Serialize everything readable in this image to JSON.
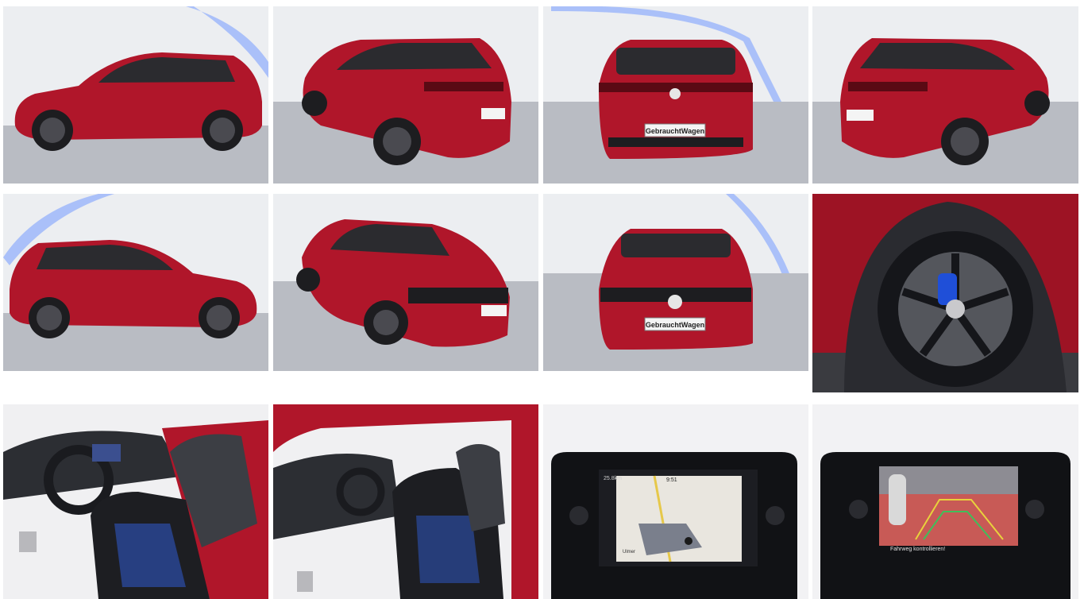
{
  "colors": {
    "body_red": "#b0162a",
    "body_red_dark": "#7c0d1c",
    "studio_wall": "#eceef1",
    "studio_floor": "#b9bcc3",
    "led_strip": "#7fa2ff",
    "caliper_blue": "#1f4fd8",
    "seat_blue": "#2f5bd0"
  },
  "gallery": {
    "photos": [
      {
        "subject": "side-left"
      },
      {
        "subject": "rear-three-quarter-left"
      },
      {
        "subject": "rear"
      },
      {
        "subject": "rear-three-quarter-right"
      },
      {
        "subject": "side-right"
      },
      {
        "subject": "front-three-quarter-left"
      },
      {
        "subject": "front"
      },
      {
        "subject": "wheel-detail"
      },
      {
        "subject": "interior-driver-seat"
      },
      {
        "subject": "interior-driver-door-open"
      },
      {
        "subject": "infotainment-navigation"
      },
      {
        "subject": "infotainment-rear-camera"
      }
    ]
  },
  "plates": {
    "rear_plate": "GebrauchtWagen",
    "front_plate": "GebrauchtWagen"
  },
  "screens": {
    "nav_top_left": "25.8km",
    "nav_clock": "9:51",
    "nav_street": "Ulmer",
    "camera_warning": "Fahrweg kontrollieren!"
  }
}
